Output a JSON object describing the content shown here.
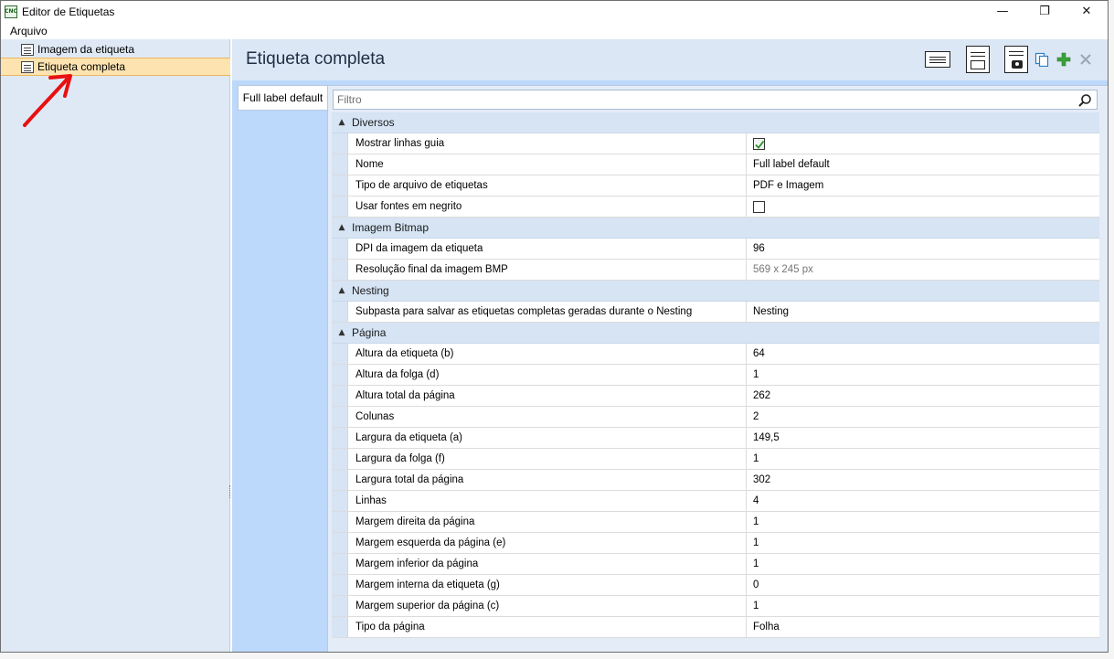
{
  "window": {
    "title": "Editor de Etiquetas",
    "app_icon_text": "CNC",
    "minimize_glyph": "—",
    "restore_glyph": "❐",
    "close_glyph": "✕"
  },
  "menu": {
    "file": "Arquivo"
  },
  "tree": {
    "items": [
      {
        "label": "Imagem da etiqueta",
        "icon": "label-image-icon",
        "selected": false
      },
      {
        "label": "Etiqueta completa",
        "icon": "full-label-icon",
        "selected": true
      }
    ]
  },
  "main": {
    "title": "Etiqueta completa",
    "tab_label": "Full label default",
    "filter_placeholder": "Filtro",
    "toolbar": [
      "label-layout-icon",
      "page-layout-icon",
      "photo-layout-icon",
      "copy-icon",
      "add-icon",
      "delete-icon"
    ]
  },
  "properties": {
    "categories": [
      {
        "name": "Diversos",
        "rows": [
          {
            "name": "Mostrar linhas guia",
            "value": "",
            "type": "checkbox",
            "checked": true
          },
          {
            "name": "Nome",
            "value": "Full label default"
          },
          {
            "name": "Tipo de arquivo de etiquetas",
            "value": "PDF e Imagem"
          },
          {
            "name": "Usar fontes em negrito",
            "value": "",
            "type": "checkbox",
            "checked": false
          }
        ]
      },
      {
        "name": "Imagem Bitmap",
        "rows": [
          {
            "name": "DPI da imagem da etiqueta",
            "value": "96"
          },
          {
            "name": "Resolução final da imagem BMP",
            "value": "569 x 245 px",
            "readonly": true
          }
        ]
      },
      {
        "name": "Nesting",
        "rows": [
          {
            "name": "Subpasta para salvar as etiquetas completas geradas durante o Nesting",
            "value": "Nesting"
          }
        ]
      },
      {
        "name": "Página",
        "rows": [
          {
            "name": "Altura da etiqueta (b)",
            "value": "64"
          },
          {
            "name": "Altura da folga (d)",
            "value": "1"
          },
          {
            "name": "Altura total da página",
            "value": "262"
          },
          {
            "name": "Colunas",
            "value": "2"
          },
          {
            "name": "Largura da etiqueta (a)",
            "value": "149,5"
          },
          {
            "name": "Largura da folga (f)",
            "value": "1"
          },
          {
            "name": "Largura total da página",
            "value": "302"
          },
          {
            "name": "Linhas",
            "value": "4"
          },
          {
            "name": "Margem direita da página",
            "value": "1"
          },
          {
            "name": "Margem esquerda da página (e)",
            "value": "1"
          },
          {
            "name": "Margem inferior da página",
            "value": "1"
          },
          {
            "name": "Margem interna da etiqueta (g)",
            "value": "0"
          },
          {
            "name": "Margem superior da página (c)",
            "value": "1"
          },
          {
            "name": "Tipo da página",
            "value": "Folha"
          }
        ]
      }
    ]
  },
  "colors": {
    "selection": "#fde3b0",
    "annotation_arrow": "#e81010",
    "add_green": "#3aa13a"
  }
}
